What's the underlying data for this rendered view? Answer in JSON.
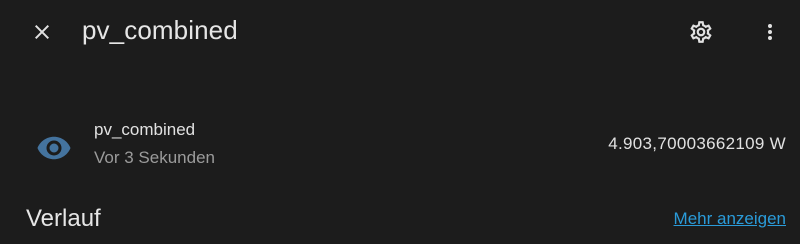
{
  "header": {
    "title": "pv_combined",
    "close_icon": "close-icon",
    "settings_icon": "gear-icon",
    "more_icon": "more-vertical-icon"
  },
  "entity": {
    "icon": "eye-icon",
    "icon_color": "#44739e",
    "name": "pv_combined",
    "last_changed": "Vor 3 Sekunden",
    "state": "4.903,70003662109 W"
  },
  "history": {
    "title": "Verlauf",
    "show_more_label": "Mehr anzeigen",
    "link_color": "#2a9bd9"
  },
  "colors": {
    "background": "#1c1c1c",
    "primary_text": "#e1e1e1",
    "secondary_text": "#9b9b9b"
  }
}
